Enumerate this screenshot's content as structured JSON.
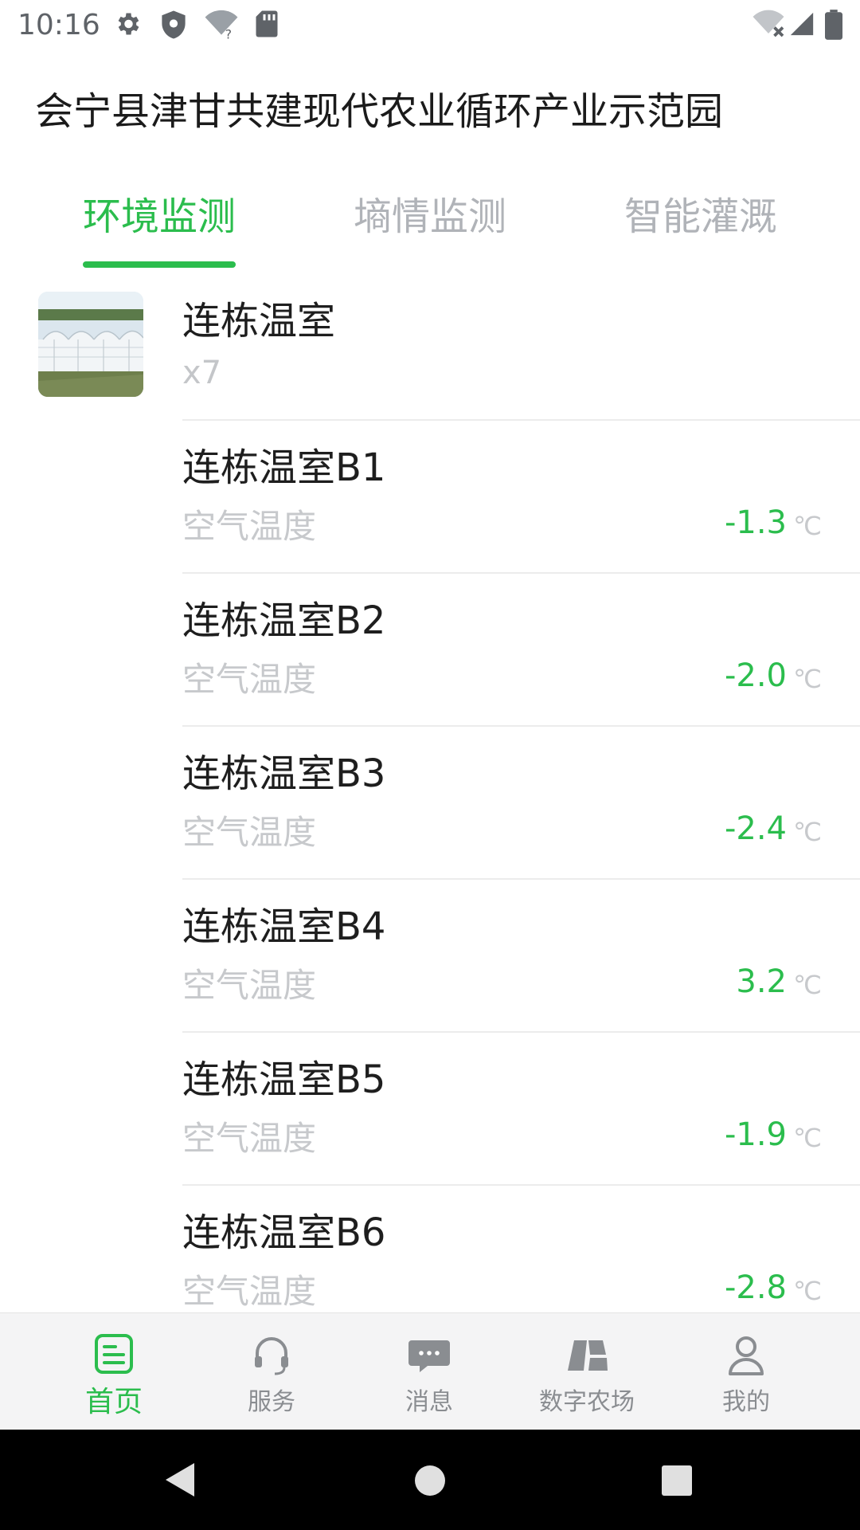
{
  "status_bar": {
    "time": "10:16",
    "left_icons": [
      "gear-icon",
      "shield-icon",
      "wifi-question-icon",
      "sd-card-icon"
    ],
    "right_icons": [
      "wifi-off-icon",
      "cell-signal-icon",
      "battery-icon"
    ]
  },
  "header": {
    "title": "会宁县津甘共建现代农业循环产业示范园"
  },
  "tabs": [
    {
      "label": "环境监测",
      "active": true
    },
    {
      "label": "墒情监测",
      "active": false
    },
    {
      "label": "智能灌溉",
      "active": false
    }
  ],
  "group": {
    "name": "连栋温室",
    "count": "x7",
    "thumbnail": "greenhouse-photo"
  },
  "rows": [
    {
      "name": "连栋温室B1",
      "label": "空气温度",
      "value": "-1.3",
      "unit": "℃"
    },
    {
      "name": "连栋温室B2",
      "label": "空气温度",
      "value": "-2.0",
      "unit": "℃"
    },
    {
      "name": "连栋温室B3",
      "label": "空气温度",
      "value": "-2.4",
      "unit": "℃"
    },
    {
      "name": "连栋温室B4",
      "label": "空气温度",
      "value": "3.2",
      "unit": "℃"
    },
    {
      "name": "连栋温室B5",
      "label": "空气温度",
      "value": "-1.9",
      "unit": "℃"
    },
    {
      "name": "连栋温室B6",
      "label": "空气温度",
      "value": "-2.8",
      "unit": "℃"
    }
  ],
  "bottom_nav": [
    {
      "label": "首页",
      "icon": "home-doc-icon",
      "active": true
    },
    {
      "label": "服务",
      "icon": "headset-icon",
      "active": false
    },
    {
      "label": "消息",
      "icon": "chat-icon",
      "active": false
    },
    {
      "label": "数字农场",
      "icon": "farm-icon",
      "active": false
    },
    {
      "label": "我的",
      "icon": "user-icon",
      "active": false
    }
  ],
  "colors": {
    "accent": "#2bbd4d",
    "muted": "#b0b3b8",
    "text": "#1e1e1e"
  }
}
